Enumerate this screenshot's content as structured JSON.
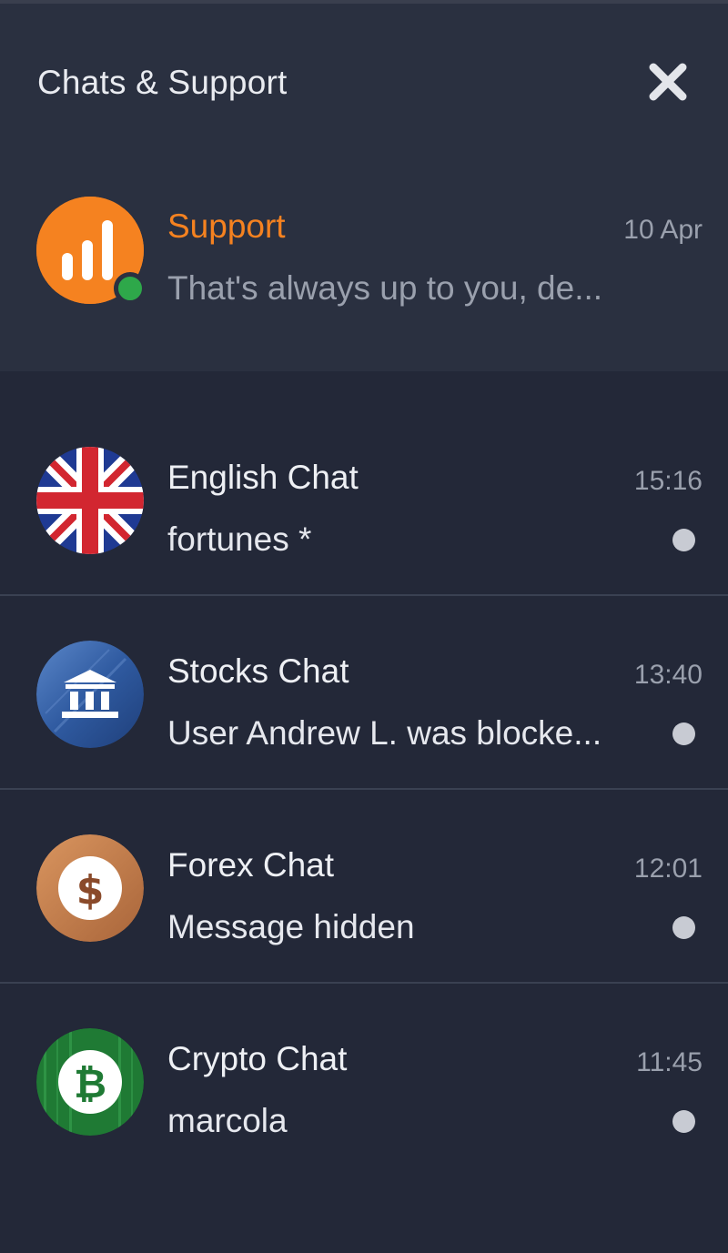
{
  "header": {
    "title": "Chats & Support",
    "close_icon": "close-icon"
  },
  "support": {
    "name": "Support",
    "time": "10 Apr",
    "preview": "That's always up to you, de...",
    "online": true,
    "avatar_icon": "bar-chart-logo-icon",
    "accent_color": "#f58220",
    "online_color": "#2ea84a"
  },
  "chats": [
    {
      "name": "English Chat",
      "time": "15:16",
      "preview": "fortunes *",
      "unread": true,
      "avatar_icon": "uk-flag-icon"
    },
    {
      "name": "Stocks Chat",
      "time": "13:40",
      "preview": "User Andrew L. was blocke...",
      "unread": true,
      "avatar_icon": "bank-building-icon"
    },
    {
      "name": "Forex Chat",
      "time": "12:01",
      "preview": "Message hidden",
      "unread": true,
      "avatar_icon": "dollar-coin-icon"
    },
    {
      "name": "Crypto Chat",
      "time": "11:45",
      "preview": "marcola",
      "unread": true,
      "avatar_icon": "bitcoin-icon"
    }
  ]
}
